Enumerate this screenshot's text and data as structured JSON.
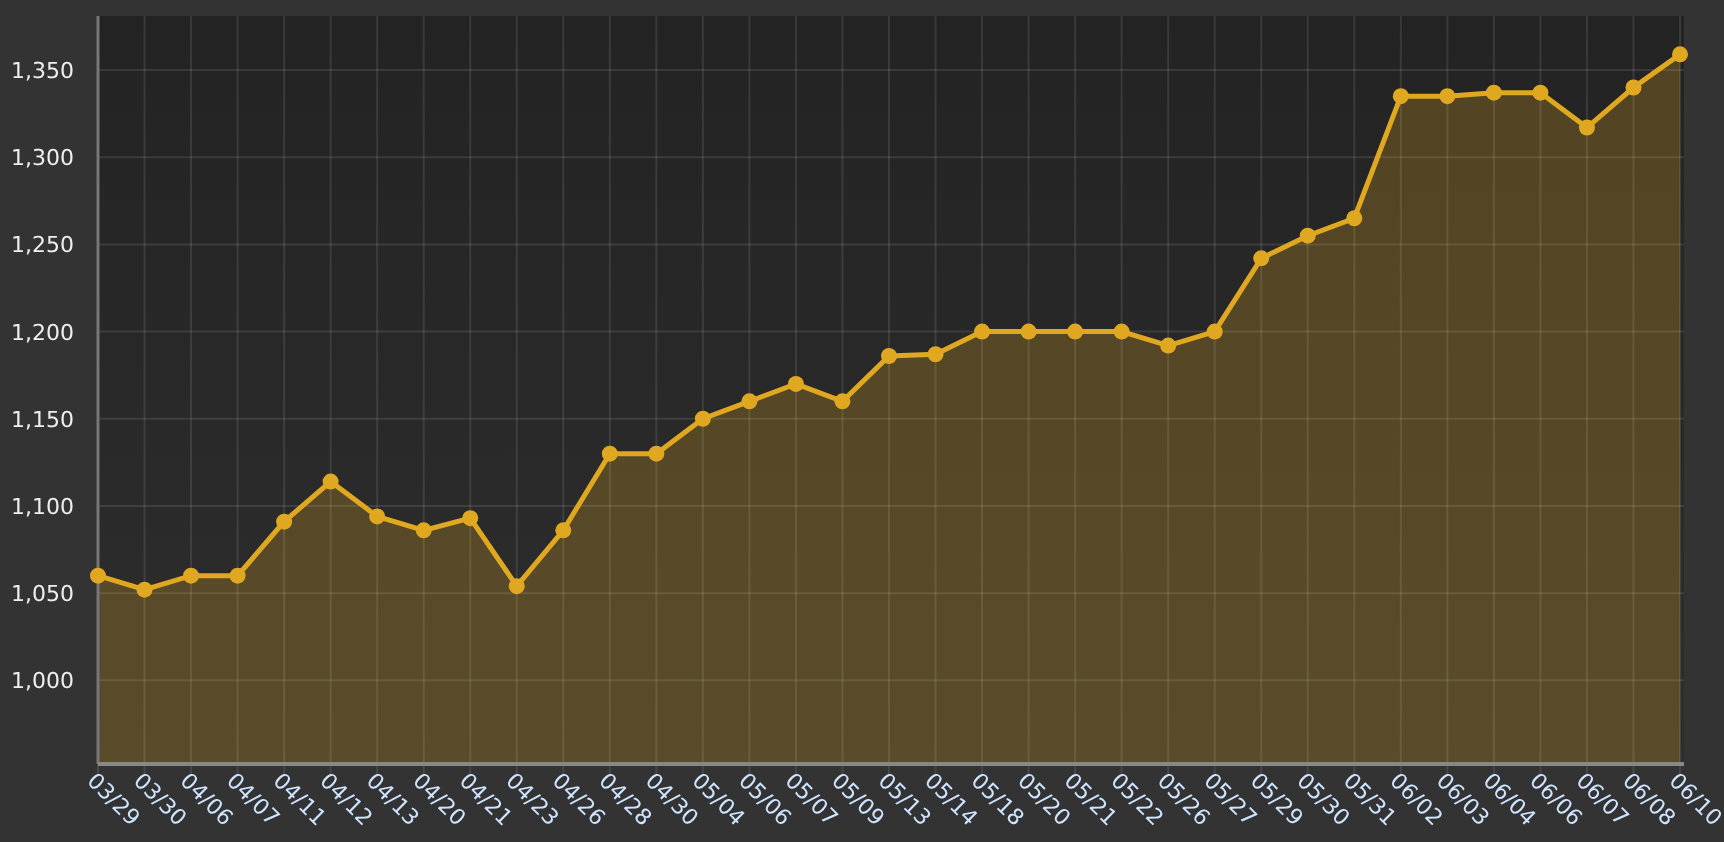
{
  "chart_data": {
    "type": "area",
    "categories": [
      "03/29",
      "03/30",
      "04/06",
      "04/07",
      "04/11",
      "04/12",
      "04/13",
      "04/20",
      "04/21",
      "04/23",
      "04/26",
      "04/28",
      "04/30",
      "05/04",
      "05/06",
      "05/07",
      "05/09",
      "05/13",
      "05/14",
      "05/18",
      "05/20",
      "05/21",
      "05/22",
      "05/26",
      "05/27",
      "05/29",
      "05/30",
      "05/31",
      "06/02",
      "06/03",
      "06/04",
      "06/06",
      "06/07",
      "06/08",
      "06/10"
    ],
    "grid": true,
    "series": [
      {
        "color": "#e0a820",
        "values": [
          1060,
          1052,
          1060,
          1060,
          1091,
          1114,
          1094,
          1086,
          1093,
          1054,
          1086,
          1130,
          1130,
          1150,
          1160,
          1170,
          1160,
          1186,
          1187,
          1200,
          1200,
          1200,
          1200,
          1192,
          1200,
          1242,
          1255,
          1265,
          1335,
          1335,
          1337,
          1337,
          1317,
          1340,
          1359
        ]
      }
    ],
    "ylim": [
      952,
      1381
    ],
    "yticks": [
      {
        "value": 1000,
        "label": "1,000"
      },
      {
        "value": 1050,
        "label": "1,050"
      },
      {
        "value": 1100,
        "label": "1,100"
      },
      {
        "value": 1150,
        "label": "1,150"
      },
      {
        "value": 1200,
        "label": "1,200"
      },
      {
        "value": 1250,
        "label": "1,250"
      },
      {
        "value": 1300,
        "label": "1,300"
      },
      {
        "value": 1350,
        "label": "1,350"
      }
    ]
  }
}
